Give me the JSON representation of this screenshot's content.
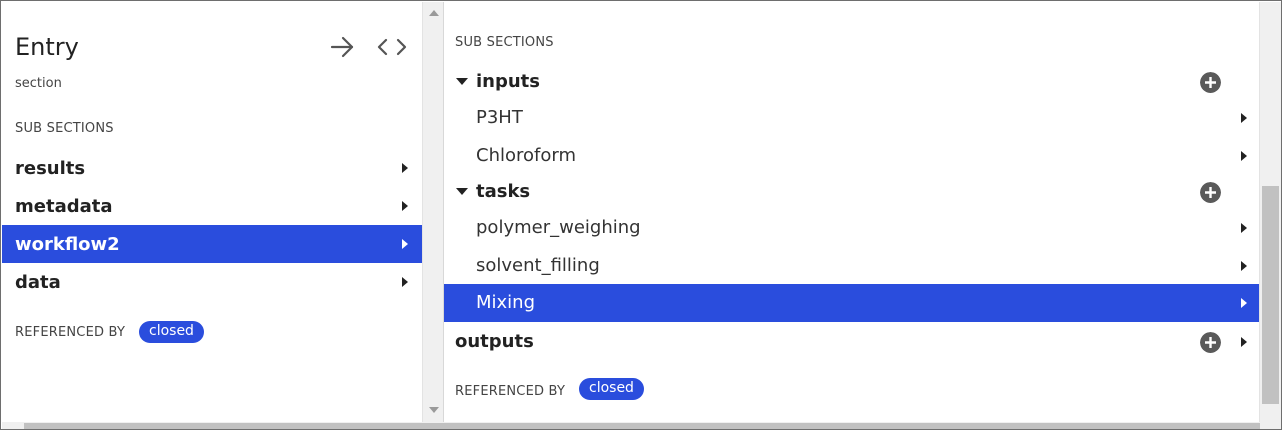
{
  "left": {
    "title": "Entry",
    "subtitle": "section",
    "subsections_label": "SUB SECTIONS",
    "items": [
      {
        "label": "results"
      },
      {
        "label": "metadata"
      },
      {
        "label": "workflow2",
        "selected": true
      },
      {
        "label": "data"
      }
    ],
    "referenced_by_label": "REFERENCED BY",
    "referenced_by_badge": "closed"
  },
  "right": {
    "subsections_label": "SUB SECTIONS",
    "groups": [
      {
        "label": "inputs",
        "items": [
          {
            "label": "P3HT"
          },
          {
            "label": "Chloroform"
          }
        ]
      },
      {
        "label": "tasks",
        "items": [
          {
            "label": "polymer_weighing"
          },
          {
            "label": "solvent_filling"
          },
          {
            "label": "Mixing",
            "selected": true
          }
        ]
      },
      {
        "label": "outputs"
      }
    ],
    "referenced_by_label": "REFERENCED BY",
    "referenced_by_badge": "closed"
  },
  "icons": {
    "header": [
      "arrow-right-icon",
      "code-icon"
    ],
    "expand": "caret-down-icon",
    "add": "plus-circle-icon",
    "navigate": "chevron-right-icon"
  },
  "colors": {
    "accent": "#2a4ddd",
    "text": "#222222",
    "icon": "#5a5a5a"
  }
}
